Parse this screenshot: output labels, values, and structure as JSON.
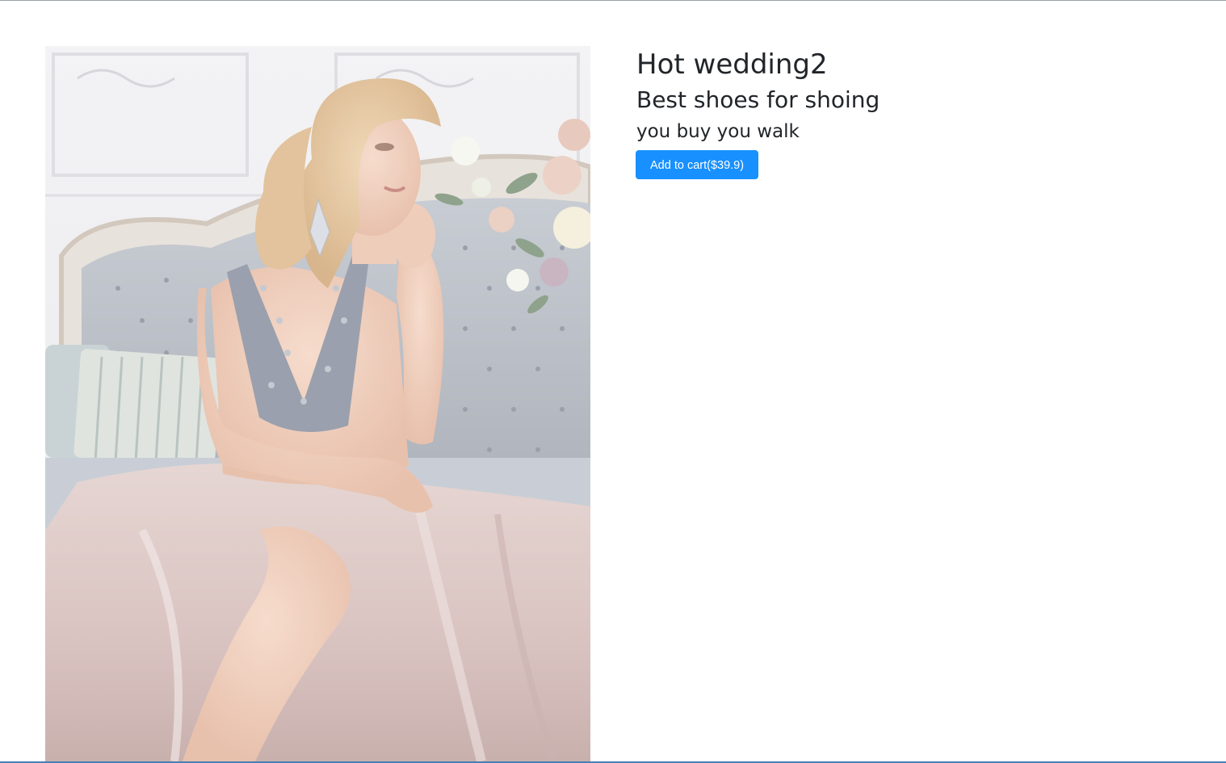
{
  "product": {
    "title": "Hot wedding2",
    "subtitle": "Best shoes for shoing",
    "tagline": "you buy you walk",
    "add_to_cart_label": "Add to cart($39.9)"
  },
  "colors": {
    "button_primary": "#1890ff",
    "text": "#212529",
    "background": "#ffffff"
  }
}
